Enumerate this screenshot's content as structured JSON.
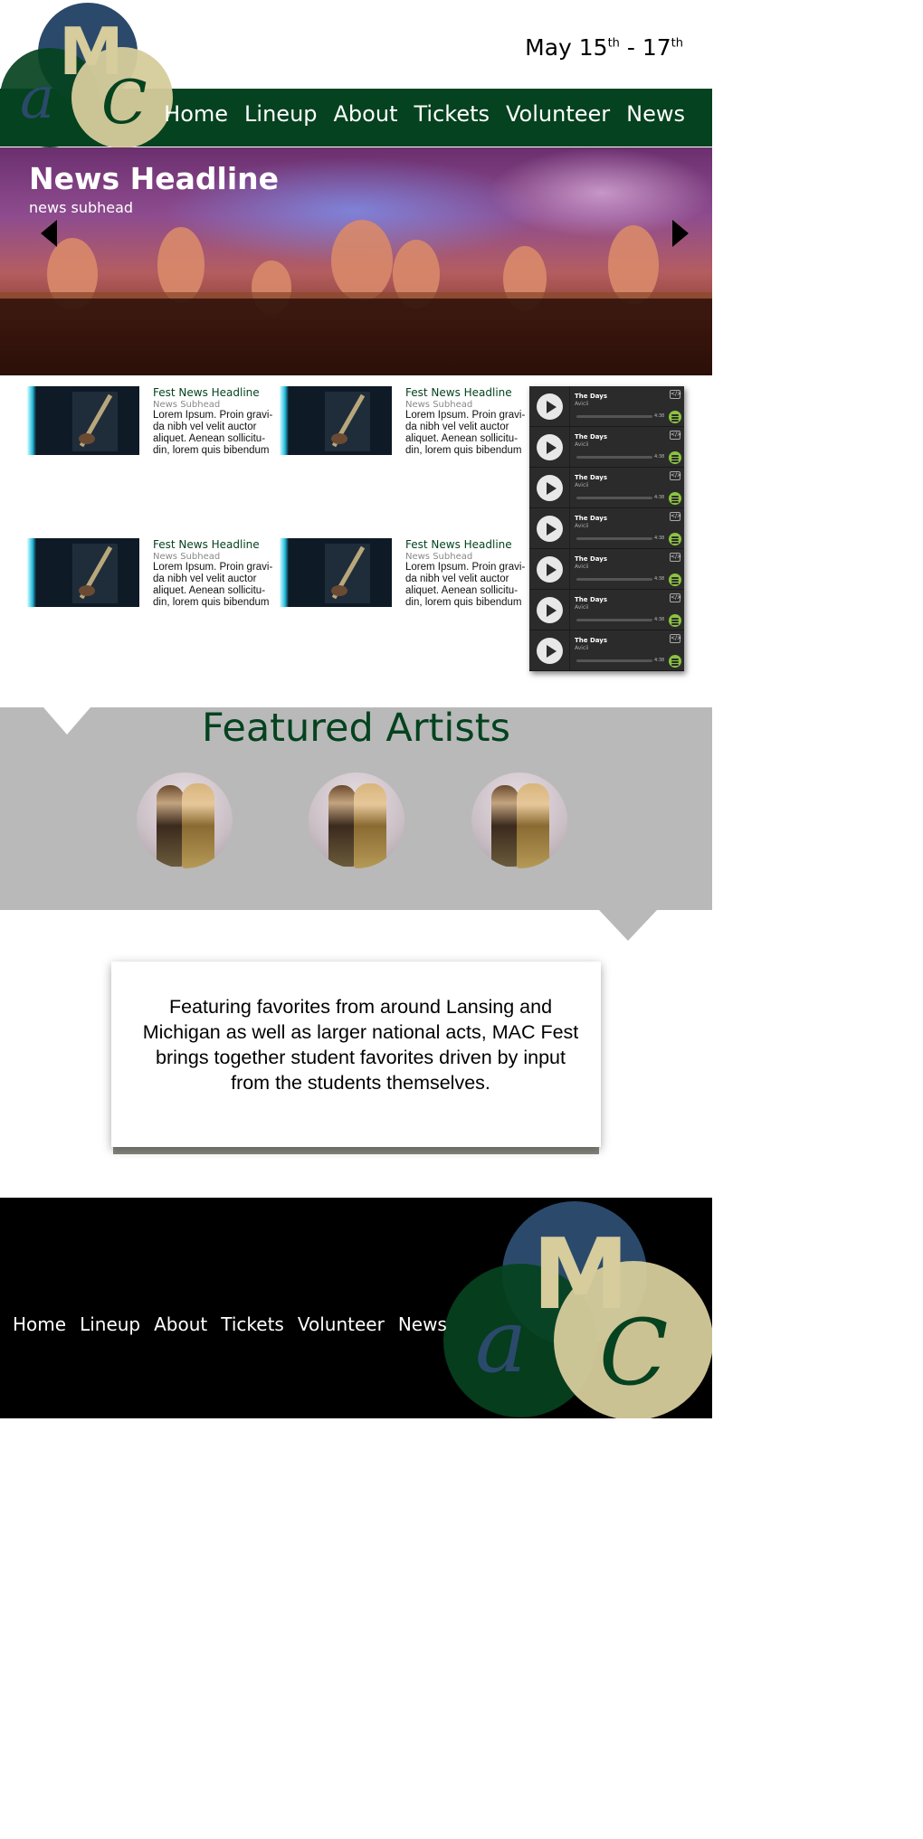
{
  "header": {
    "date_main": "May 15",
    "date_sup1": "th",
    "date_sep": " - 17",
    "date_sup2": "th"
  },
  "logo": {
    "letters": [
      "M",
      "a",
      "C"
    ]
  },
  "nav": [
    "Home",
    "Lineup",
    "About",
    "Tickets",
    "Volunteer",
    "News"
  ],
  "hero": {
    "headline": "News Headline",
    "subhead": "news subhead"
  },
  "news": [
    {
      "headline": "Fest News Headline",
      "subhead": "News Subhead",
      "body": "Lorem Ipsum. Proin gravi-da nibh vel velit auctor aliquet. Aenean sollicitu-din, lorem quis bibendum"
    },
    {
      "headline": "Fest News Headline",
      "subhead": "News Subhead",
      "body": "Lorem Ipsum. Proin gravi-da nibh vel velit auctor aliquet. Aenean sollicitu-din, lorem quis bibendum"
    },
    {
      "headline": "Fest News Headline",
      "subhead": "News Subhead",
      "body": "Lorem Ipsum. Proin gravi-da nibh vel velit auctor aliquet. Aenean sollicitu-din, lorem quis bibendum"
    },
    {
      "headline": "Fest News Headline",
      "subhead": "News Subhead",
      "body": "Lorem Ipsum. Proin gravi-da nibh vel velit auctor aliquet. Aenean sollicitu-din, lorem quis bibendum"
    }
  ],
  "player": {
    "tracks": [
      {
        "title": "The Days",
        "artist": "Avicii",
        "duration": "4:38",
        "embed": "</>"
      },
      {
        "title": "The Days",
        "artist": "Avicii",
        "duration": "4:38",
        "embed": "</>"
      },
      {
        "title": "The Days",
        "artist": "Avicii",
        "duration": "4:38",
        "embed": "</>"
      },
      {
        "title": "The Days",
        "artist": "Avicii",
        "duration": "4:38",
        "embed": "</>"
      },
      {
        "title": "The Days",
        "artist": "Avicii",
        "duration": "4:38",
        "embed": "</>"
      },
      {
        "title": "The Days",
        "artist": "Avicii",
        "duration": "4:38",
        "embed": "</>"
      },
      {
        "title": "The Days",
        "artist": "Avicii",
        "duration": "4:38",
        "embed": "</>"
      }
    ]
  },
  "featured": {
    "title": "Featured Artists",
    "artist_count": 3
  },
  "description": {
    "text": "Featuring favorites from around Lansing and Michigan as well as larger national acts, MAC Fest brings together student favorites driven by input from the students themselves."
  },
  "colors": {
    "brand_green": "#05421f",
    "logo_blue": "#2b4a6b",
    "logo_cream": "#d6cc9c",
    "featured_bg": "#b9b9b9",
    "spotify_green": "#8bc43f"
  }
}
